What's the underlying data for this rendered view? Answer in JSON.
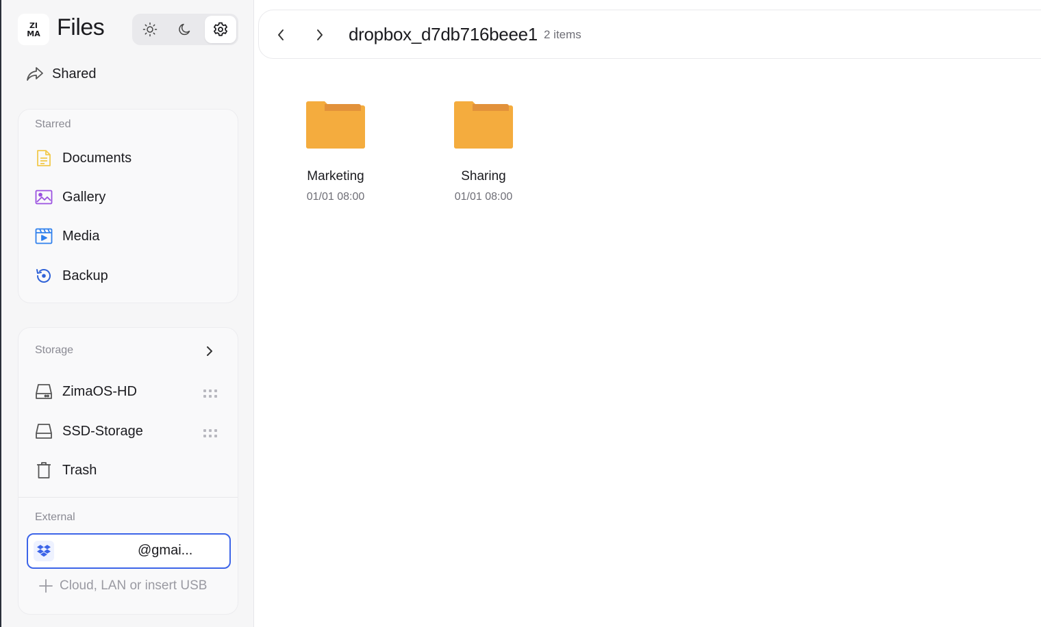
{
  "app": {
    "title": "Files",
    "logo_text_top": "ZI",
    "logo_text_bottom": "MA"
  },
  "theme_toggle": {
    "options": [
      "light",
      "dark",
      "auto"
    ],
    "selected": "auto"
  },
  "nav": {
    "shared_label": "Shared"
  },
  "starred": {
    "label": "Starred",
    "items": [
      {
        "label": "Documents",
        "icon": "document-icon",
        "color": "#f2c94c"
      },
      {
        "label": "Gallery",
        "icon": "image-icon",
        "color": "#9b51e0"
      },
      {
        "label": "Media",
        "icon": "film-icon",
        "color": "#2f80ed"
      },
      {
        "label": "Backup",
        "icon": "backup-icon",
        "color": "#2f62d8"
      }
    ]
  },
  "storage": {
    "label": "Storage",
    "items": [
      {
        "label": "ZimaOS-HD",
        "icon": "hard-drive-icon"
      },
      {
        "label": "SSD-Storage",
        "icon": "drive-icon"
      },
      {
        "label": "Trash",
        "icon": "trash-icon"
      }
    ]
  },
  "external": {
    "label": "External",
    "account_text": "@gmai...",
    "add_label": "Cloud, LAN or insert USB"
  },
  "main": {
    "path_title": "dropbox_d7db716beee1",
    "item_count": "2 items",
    "files": [
      {
        "name": "Marketing",
        "date": "01/01 08:00",
        "type": "folder"
      },
      {
        "name": "Sharing",
        "date": "01/01 08:00",
        "type": "folder"
      }
    ]
  },
  "colors": {
    "accent": "#3c64e8",
    "folder": "#f4ac3e",
    "folder_tab": "#e2913a"
  }
}
